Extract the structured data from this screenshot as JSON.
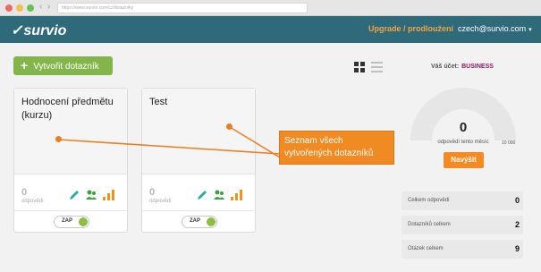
{
  "browser": {
    "url": "https://www.survio.com/cz/dotazniky"
  },
  "header": {
    "logo": "survio",
    "upgrade": "Upgrade / prodloužení",
    "account": "czech@survio.com"
  },
  "toolbar": {
    "create_label": "Vytvořit dotazník"
  },
  "cards": [
    {
      "title": "Hodnocení předmětu (kurzu)",
      "count": "0",
      "count_label": "odpovědí",
      "toggle_label": "ZAP"
    },
    {
      "title": "Test",
      "count": "0",
      "count_label": "odpovědí",
      "toggle_label": "ZAP"
    }
  ],
  "callout": {
    "line1": "Seznam všech",
    "line2": "vytvořených dotazníků"
  },
  "account_panel": {
    "label": "Váš účet:",
    "plan": "BUSINESS",
    "gauge_value": "0",
    "gauge_label": "odpovědí tento měsíc",
    "gauge_max": "10 000",
    "buy_label": "Navýšit"
  },
  "stats": [
    {
      "name": "Celkem odpovědí",
      "value": "0"
    },
    {
      "name": "Dotazníků celkem",
      "value": "2"
    },
    {
      "name": "Otázek celkem",
      "value": "9"
    }
  ],
  "colors": {
    "header": "#2f6a7b",
    "accent_orange": "#f08a22",
    "accent_green": "#84b54a",
    "plan": "#8b1a5a"
  },
  "icons": [
    "plus-icon",
    "grid-view-icon",
    "list-view-icon",
    "pencil-icon",
    "users-icon",
    "bar-chart-icon",
    "caret-down-icon"
  ]
}
